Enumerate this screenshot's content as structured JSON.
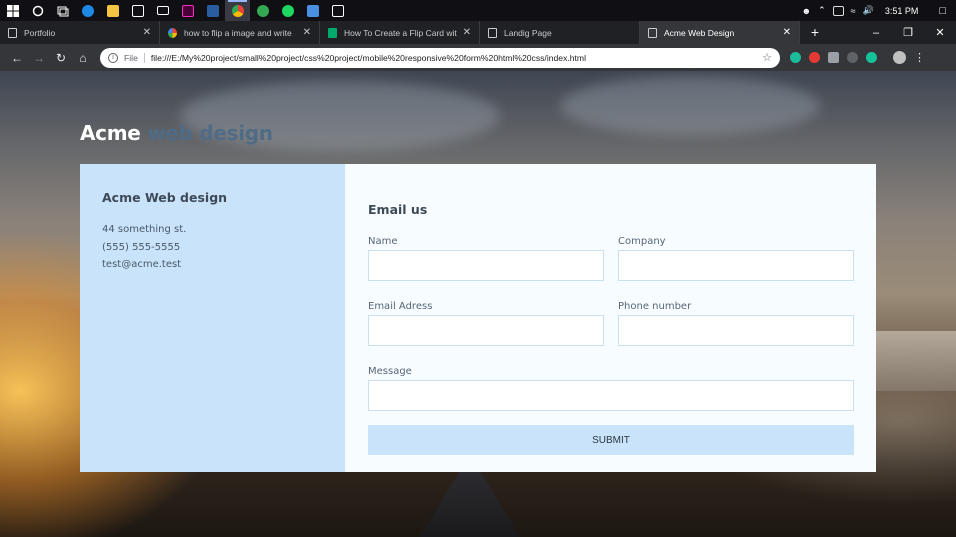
{
  "taskbar": {
    "icons": [
      {
        "name": "windows-start-icon",
        "color": "#ffffff"
      },
      {
        "name": "cortana-icon",
        "color": "#ffffff"
      },
      {
        "name": "task-view-icon",
        "color": "#ffffff"
      },
      {
        "name": "edge-icon",
        "color": "#1e88e5"
      },
      {
        "name": "file-explorer-icon",
        "color": "#f4c542"
      },
      {
        "name": "store-icon",
        "color": "#ffffff"
      },
      {
        "name": "mail-icon",
        "color": "#ffffff"
      },
      {
        "name": "adobe-xd-icon",
        "color": "#ff2bc2"
      },
      {
        "name": "powershell-icon",
        "color": "#2a5d9f"
      },
      {
        "name": "chrome-icon",
        "color": "#f1b31c"
      },
      {
        "name": "chrome-canary-icon",
        "color": "#34a853"
      },
      {
        "name": "spotify-icon",
        "color": "#1ed760"
      },
      {
        "name": "remote-desktop-icon",
        "color": "#4a90e2"
      },
      {
        "name": "photos-icon",
        "color": "#ffffff"
      }
    ],
    "time": "3:51 PM"
  },
  "browser": {
    "tabs": [
      {
        "title": "Portfolio",
        "favicon": "page"
      },
      {
        "title": "how to flip a image and write",
        "favicon": "g"
      },
      {
        "title": "How To Create a Flip Card with",
        "favicon": "w3"
      },
      {
        "title": "Landig Page",
        "favicon": "page"
      },
      {
        "title": "Acme Web Design",
        "favicon": "page"
      }
    ],
    "active_tab": 4,
    "scheme": "File",
    "url": "file:///E:/My%20project/small%20project/css%20project/mobile%20responsive%20form%20html%20css/index.html"
  },
  "page": {
    "brand_first": "Acme",
    "brand_second": "web design",
    "brand_second_color": "#4f6b86",
    "info": {
      "company": "Acme Web design",
      "address": "44 something st.",
      "phone": "(555) 555-5555",
      "email": "test@acme.test"
    },
    "form": {
      "heading": "Email us",
      "name_label": "Name",
      "company_label": "Company",
      "email_label": "Email Adress",
      "phone_label": "Phone number",
      "message_label": "Message",
      "submit_label": "SUBMIT"
    },
    "accent": "#c9e4fa"
  }
}
